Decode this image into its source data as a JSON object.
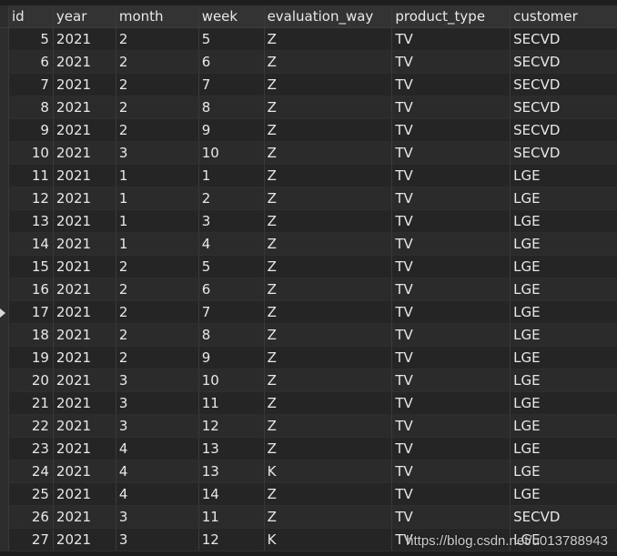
{
  "columns": [
    "id",
    "year",
    "month",
    "week",
    "evaluation_way",
    "product_type",
    "customer"
  ],
  "rows": [
    [
      "5",
      "2021",
      "2",
      "5",
      "Z",
      "TV",
      "SECVD"
    ],
    [
      "6",
      "2021",
      "2",
      "6",
      "Z",
      "TV",
      "SECVD"
    ],
    [
      "7",
      "2021",
      "2",
      "7",
      "Z",
      "TV",
      "SECVD"
    ],
    [
      "8",
      "2021",
      "2",
      "8",
      "Z",
      "TV",
      "SECVD"
    ],
    [
      "9",
      "2021",
      "2",
      "9",
      "Z",
      "TV",
      "SECVD"
    ],
    [
      "10",
      "2021",
      "3",
      "10",
      "Z",
      "TV",
      "SECVD"
    ],
    [
      "11",
      "2021",
      "1",
      "1",
      "Z",
      "TV",
      "LGE"
    ],
    [
      "12",
      "2021",
      "1",
      "2",
      "Z",
      "TV",
      "LGE"
    ],
    [
      "13",
      "2021",
      "1",
      "3",
      "Z",
      "TV",
      "LGE"
    ],
    [
      "14",
      "2021",
      "1",
      "4",
      "Z",
      "TV",
      "LGE"
    ],
    [
      "15",
      "2021",
      "2",
      "5",
      "Z",
      "TV",
      "LGE"
    ],
    [
      "16",
      "2021",
      "2",
      "6",
      "Z",
      "TV",
      "LGE"
    ],
    [
      "17",
      "2021",
      "2",
      "7",
      "Z",
      "TV",
      "LGE"
    ],
    [
      "18",
      "2021",
      "2",
      "8",
      "Z",
      "TV",
      "LGE"
    ],
    [
      "19",
      "2021",
      "2",
      "9",
      "Z",
      "TV",
      "LGE"
    ],
    [
      "20",
      "2021",
      "3",
      "10",
      "Z",
      "TV",
      "LGE"
    ],
    [
      "21",
      "2021",
      "3",
      "11",
      "Z",
      "TV",
      "LGE"
    ],
    [
      "22",
      "2021",
      "3",
      "12",
      "Z",
      "TV",
      "LGE"
    ],
    [
      "23",
      "2021",
      "4",
      "13",
      "Z",
      "TV",
      "LGE"
    ],
    [
      "24",
      "2021",
      "4",
      "13",
      "K",
      "TV",
      "LGE"
    ],
    [
      "25",
      "2021",
      "4",
      "14",
      "Z",
      "TV",
      "LGE"
    ],
    [
      "26",
      "2021",
      "3",
      "11",
      "Z",
      "TV",
      "SECVD"
    ],
    [
      "27",
      "2021",
      "3",
      "12",
      "K",
      "TV",
      "LGE"
    ]
  ],
  "current_row_index": 12,
  "watermark": "https://blog.csdn.net/u013788943",
  "colors": {
    "background": "#1e1e1e",
    "row": "#252526",
    "row_alt": "#2b2b2b",
    "header": "#333333",
    "text": "#e8e8e8"
  },
  "icons": {
    "current_row_marker": "triangle-right-icon"
  }
}
